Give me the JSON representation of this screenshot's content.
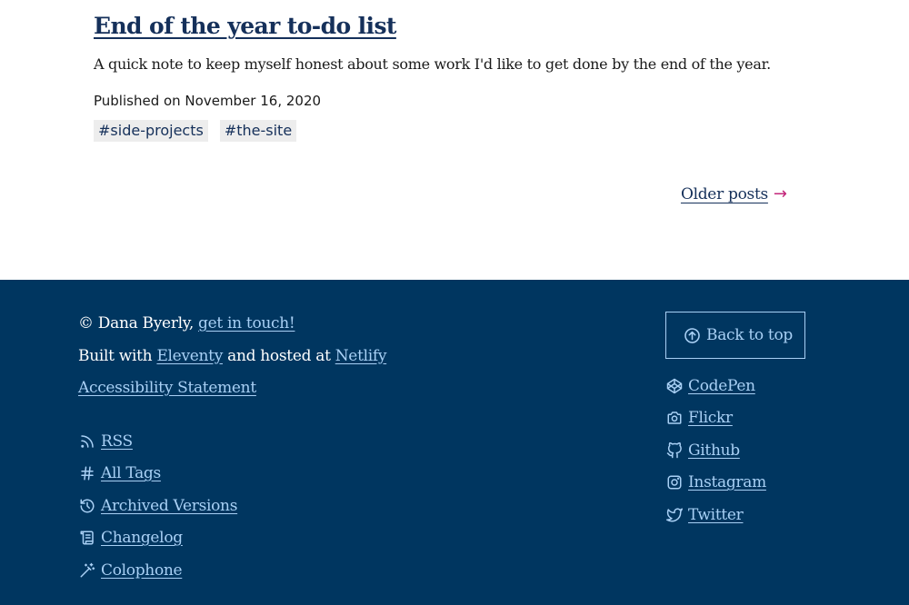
{
  "post": {
    "title": "End of the year to-do list",
    "excerpt": "A quick note to keep myself honest about some work I'd like to get done by the end of the year.",
    "published": "Published on November 16, 2020",
    "tags": [
      "#side-projects",
      "#the-site"
    ]
  },
  "pagination": {
    "older_label": "Older posts",
    "arrow": "→"
  },
  "footer": {
    "copyright_prefix": "© Dana Byerly, ",
    "contact_link": "get in touch!",
    "built_prefix": "Built with ",
    "eleventy": "Eleventy",
    "built_mid": " and hosted at ",
    "netlify": "Netlify",
    "accessibility": "Accessibility Statement",
    "links": [
      {
        "label": "RSS",
        "icon": "rss-icon"
      },
      {
        "label": "All Tags",
        "icon": "hash-icon"
      },
      {
        "label": "Archived Versions",
        "icon": "history-icon"
      },
      {
        "label": "Changelog",
        "icon": "scroll-icon"
      },
      {
        "label": "Colophone",
        "icon": "magic-wand-icon"
      }
    ],
    "back_to_top": "Back to top",
    "social": [
      {
        "label": "CodePen",
        "icon": "codepen-icon"
      },
      {
        "label": "Flickr",
        "icon": "camera-icon"
      },
      {
        "label": "Github",
        "icon": "github-icon"
      },
      {
        "label": "Instagram",
        "icon": "instagram-icon"
      },
      {
        "label": "Twitter",
        "icon": "twitter-icon"
      }
    ],
    "colors": {
      "background": "#003660",
      "link": "#a9d0f5",
      "accent": "#c3267a",
      "title": "#15305a"
    }
  }
}
